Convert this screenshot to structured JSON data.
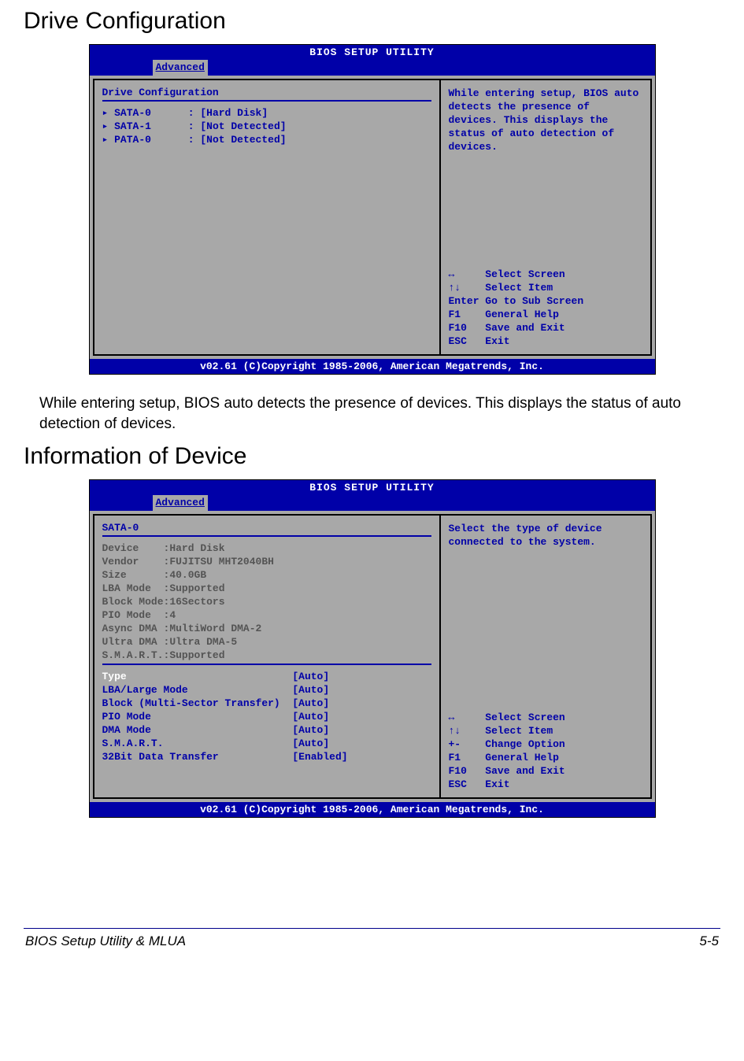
{
  "headings": {
    "drive_config": "Drive Configuration",
    "info_device": "Information of Device"
  },
  "bios_common": {
    "title": "BIOS SETUP UTILITY",
    "tab": "Advanced",
    "footer": "v02.61 (C)Copyright 1985-2006, American Megatrends, Inc."
  },
  "screen1": {
    "left_title": "Drive Configuration",
    "drives": [
      {
        "name": "SATA-0",
        "value": "[Hard Disk]"
      },
      {
        "name": "SATA-1",
        "value": "[Not Detected]"
      },
      {
        "name": "PATA-0",
        "value": "[Not Detected]"
      }
    ],
    "help": "While entering setup, BIOS auto detects the presence of devices. This displays the status of auto detection of devices.",
    "nav": [
      {
        "key": "↔",
        "label": "Select Screen"
      },
      {
        "key": "↑↓",
        "label": "Select Item"
      },
      {
        "key": "Enter",
        "label": "Go to Sub Screen"
      },
      {
        "key": "F1",
        "label": "General Help"
      },
      {
        "key": "F10",
        "label": "Save and Exit"
      },
      {
        "key": "ESC",
        "label": "Exit"
      }
    ]
  },
  "body_paragraph": "While entering setup, BIOS auto detects the presence of devices. This displays the status of auto detection of devices.",
  "screen2": {
    "left_title": "SATA-0",
    "info": [
      {
        "label": "Device",
        "value": "Hard Disk"
      },
      {
        "label": "Vendor",
        "value": "FUJITSU MHT2040BH"
      },
      {
        "label": "Size",
        "value": "40.0GB"
      },
      {
        "label": "LBA Mode",
        "value": "Supported"
      },
      {
        "label": "Block Mode",
        "value": "16Sectors"
      },
      {
        "label": "PIO Mode",
        "value": "4"
      },
      {
        "label": "Async DMA",
        "value": "MultiWord DMA-2"
      },
      {
        "label": "Ultra DMA",
        "value": "Ultra DMA-5"
      },
      {
        "label": "S.M.A.R.T.",
        "value": "Supported"
      }
    ],
    "settings": [
      {
        "label": "Type",
        "value": "[Auto]"
      },
      {
        "label": "LBA/Large Mode",
        "value": "[Auto]"
      },
      {
        "label": "Block (Multi-Sector Transfer)",
        "value": "[Auto]"
      },
      {
        "label": "PIO Mode",
        "value": "[Auto]"
      },
      {
        "label": "DMA Mode",
        "value": "[Auto]"
      },
      {
        "label": "S.M.A.R.T.",
        "value": "[Auto]"
      },
      {
        "label": "32Bit Data Transfer",
        "value": "[Enabled]"
      }
    ],
    "help": "Select the type of device connected to the system.",
    "nav": [
      {
        "key": "↔",
        "label": "Select Screen"
      },
      {
        "key": "↑↓",
        "label": "Select Item"
      },
      {
        "key": "+-",
        "label": "Change Option"
      },
      {
        "key": "F1",
        "label": "General Help"
      },
      {
        "key": "F10",
        "label": "Save and Exit"
      },
      {
        "key": "ESC",
        "label": "Exit"
      }
    ]
  },
  "footer": {
    "left": "BIOS Setup Utility & MLUA",
    "right": "5-5"
  }
}
